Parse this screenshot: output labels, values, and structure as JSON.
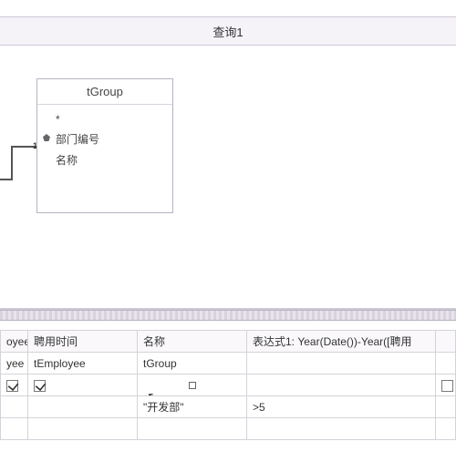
{
  "titlebar": {
    "text": "查询1"
  },
  "entity": {
    "name": "tGroup",
    "star": "*",
    "fields": [
      "部门编号",
      "名称"
    ]
  },
  "join": {
    "end_label": "1"
  },
  "grid": {
    "headers": {
      "stub": "oyee",
      "col1": "聘用时间",
      "col2": "名称",
      "col3": "表达式1: Year(Date())-Year([聘用"
    },
    "tables": {
      "stub": "yee",
      "col1": "tEmployee",
      "col2": "tGroup",
      "col3": ""
    },
    "show": {
      "stub_checked": true,
      "col1_checked": true,
      "col2_checked": false,
      "col3_checked": false
    },
    "criteria": {
      "col2": "\"开发部\"",
      "col3": ">5"
    }
  }
}
